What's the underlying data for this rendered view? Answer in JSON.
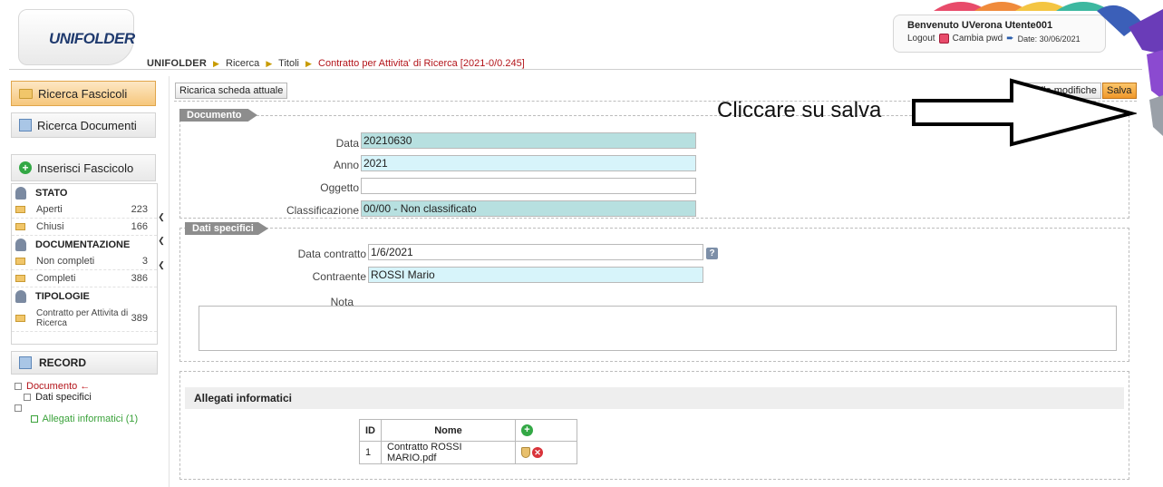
{
  "header": {
    "logo_text": "UNIFOLDER",
    "breadcrumb": {
      "brand": "UNIFOLDER",
      "items": [
        "Ricerca",
        "Titoli"
      ],
      "current": "Contratto per Attivita' di Ricerca [2021-0/0.245]"
    },
    "user": {
      "welcome": "Benvenuto UVerona Utente001",
      "logout": "Logout",
      "change_pwd": "Cambia pwd",
      "date": "Date: 30/06/2021"
    }
  },
  "sidebar": {
    "ricerca_fascicoli": "Ricerca Fascicoli",
    "ricerca_documenti": "Ricerca Documenti",
    "inserisci_fascicolo": "Inserisci Fascicolo",
    "stato": {
      "title": "STATO",
      "items": [
        {
          "label": "Aperti",
          "count": "223"
        },
        {
          "label": "Chiusi",
          "count": "166"
        }
      ]
    },
    "documentazione": {
      "title": "DOCUMENTAZIONE",
      "items": [
        {
          "label": "Non completi",
          "count": "3"
        },
        {
          "label": "Completi",
          "count": "386"
        }
      ]
    },
    "tipologie": {
      "title": "TIPOLOGIE",
      "items": [
        {
          "label": "Contratto per Attivita di Ricerca",
          "count": "389"
        }
      ]
    },
    "record": "RECORD",
    "tree": {
      "documento": "Documento",
      "dati_specifici": "Dati specifici",
      "allegati": "Allegati informatici (1)"
    }
  },
  "toolbar": {
    "reload": "Ricarica scheda attuale",
    "annulla": "Annulla modifiche",
    "salva": "Salva"
  },
  "documento": {
    "legend": "Documento",
    "data_label": "Data",
    "data_value": "20210630",
    "anno_label": "Anno",
    "anno_value": "2021",
    "oggetto_label": "Oggetto",
    "oggetto_value": "",
    "classificazione_label": "Classificazione",
    "classificazione_value": "00/00 - Non classificato"
  },
  "dati_specifici": {
    "legend": "Dati specifici",
    "data_contratto_label": "Data contratto",
    "data_contratto_value": "1/6/2021",
    "help": "?",
    "contraente_label": "Contraente",
    "contraente_value": "ROSSI Mario",
    "nota_label": "Nota"
  },
  "allegati": {
    "title": "Allegati informatici",
    "columns": [
      "ID",
      "Nome"
    ],
    "rows": [
      {
        "id": "1",
        "nome": "Contratto ROSSI MARIO.pdf"
      }
    ]
  },
  "annotation": {
    "text": "Cliccare su salva"
  }
}
